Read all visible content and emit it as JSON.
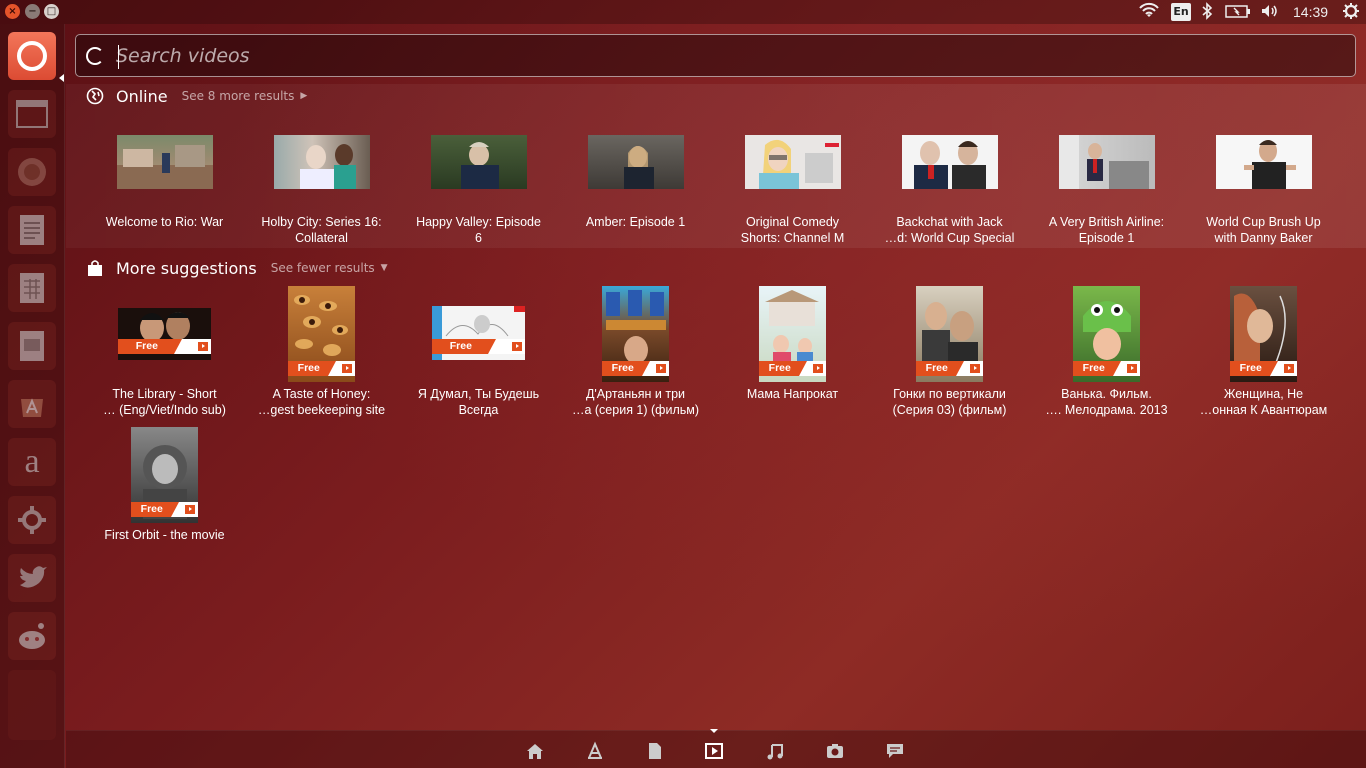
{
  "topbar": {
    "window_close": "×",
    "window_minimize": "−",
    "window_maximize": "□",
    "keyboard_layout": "En",
    "clock": "14:39",
    "icons": [
      "wifi-icon",
      "keyboard-icon",
      "bluetooth-icon",
      "battery-icon",
      "volume-icon",
      "session-gear-icon"
    ]
  },
  "launcher": {
    "items": [
      "dash-icon",
      "files-icon",
      "firefox-icon",
      "writer-icon",
      "calc-icon",
      "impress-icon",
      "software-center-icon",
      "amazon-icon",
      "system-settings-icon",
      "twitter-icon",
      "reddit-icon"
    ],
    "amazon_glyph": "a"
  },
  "search": {
    "placeholder": "Search videos",
    "value": ""
  },
  "online": {
    "title": "Online",
    "link": "See 8 more results",
    "items": [
      {
        "label": "Welcome to Rio: War"
      },
      {
        "label": "Holby City: Series 16:\nCollateral"
      },
      {
        "label": "Happy Valley: Episode\n6"
      },
      {
        "label": "Amber: Episode 1"
      },
      {
        "label": "Original Comedy\nShorts: Channel M"
      },
      {
        "label": "Backchat with Jack\n…d: World Cup Special"
      },
      {
        "label": "A Very British Airline:\nEpisode 1"
      },
      {
        "label": "World Cup Brush Up\nwith Danny Baker"
      }
    ]
  },
  "suggestions": {
    "title": "More suggestions",
    "link": "See fewer results",
    "free_label": "Free",
    "items": [
      {
        "label": "The Library - Short\n… (Eng/Viet/Indo sub)"
      },
      {
        "label": "A Taste of Honey:\n…gest beekeeping site"
      },
      {
        "label": "Я Думал, Ты Будешь\nВсегда"
      },
      {
        "label": "Д'Артаньян и три\n…а (серия 1) (фильм)"
      },
      {
        "label": "Мама Напрокат"
      },
      {
        "label": "Гонки по вертикали\n(Серия 03) (фильм)"
      },
      {
        "label": "Ванька. Фильм.\n…. Мелодрама. 2013"
      },
      {
        "label": "Женщина, Не\n…онная К Авантюрам"
      },
      {
        "label": "First Orbit - the movie"
      }
    ]
  },
  "lensbar": {
    "lenses": [
      "home-lens-icon",
      "applications-lens-icon",
      "files-lens-icon",
      "video-lens-icon",
      "music-lens-icon",
      "photo-lens-icon",
      "social-lens-icon"
    ],
    "active": "video-lens-icon"
  }
}
